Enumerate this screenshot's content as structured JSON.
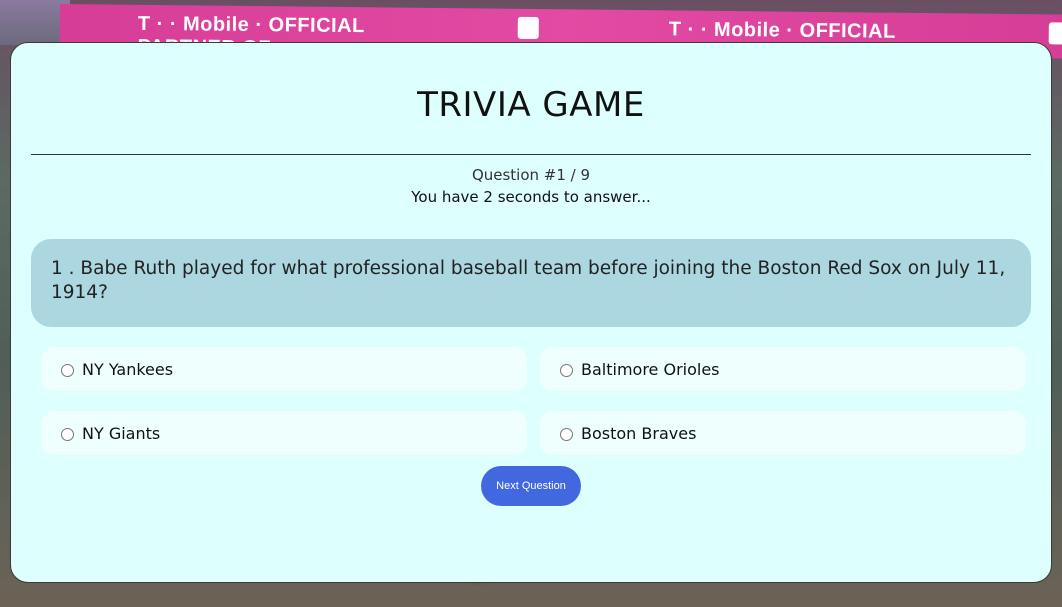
{
  "background": {
    "banner_text_1": "T · · Mobile · OFFICIAL PARTNER OF",
    "banner_text_2": "T · · Mobile · OFFICIAL PARTNER OF",
    "banner_color": "#d63d96"
  },
  "game": {
    "title": "TRIVIA GAME",
    "question_counter": "Question #1 / 9",
    "timer_text": "You have 2 seconds to answer...",
    "question_text": "1 . Babe Ruth played for what professional baseball team before joining the Boston Red Sox on July 11, 1914?",
    "options": [
      {
        "label": "NY Yankees",
        "selected": false
      },
      {
        "label": "Baltimore Orioles",
        "selected": false
      },
      {
        "label": "NY Giants",
        "selected": false
      },
      {
        "label": "Boston Braves",
        "selected": false
      }
    ],
    "next_label": "Next Question"
  },
  "colors": {
    "card_bg": "#ddfffe",
    "question_bg": "#acd7e1",
    "option_bg": "#eefffe",
    "button_bg": "#4268e0"
  }
}
